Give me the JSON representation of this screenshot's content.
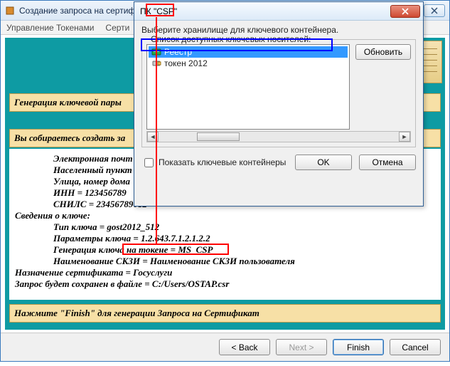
{
  "main": {
    "title": "Создание запроса на сертиф",
    "menu": {
      "tokens": "Управление Токенами",
      "certs": "Серти"
    }
  },
  "sections": {
    "keygen": "Генерация ключевой пары",
    "about_to_create": "Вы собираетесь создать за",
    "press_finish": "Нажмите \"Finish\" для генерации Запроса на Сертификат"
  },
  "details": {
    "email": "Электронная почт",
    "locality": "Населенный пункт",
    "street": "Улица, номер дома",
    "inn": "ИНН = 123456789",
    "snils": "СНИЛС = 23456789012",
    "key_heading": "Сведения о ключе:",
    "key_type": "Тип ключа = gost2012_512",
    "key_params": "Параметры ключа = 1.2.643.7.1.2.1.2.2",
    "key_on_token": "Генерация ключа на токене = MS_CSP",
    "skzi_name": "Наименование СКЗИ = Наименование СКЗИ пользователя",
    "purpose": "Назначение сертификата = Госуслуги",
    "save_path": "Запрос будет сохранен в файле = C:/Users/OSTAP.csr"
  },
  "footer": {
    "back": "< Back",
    "next": "Next >",
    "finish": "Finish",
    "cancel": "Cancel"
  },
  "dialog": {
    "title": "ПК \"CSP\"",
    "prompt": "Выберите хранилище для ключевого контейнера.",
    "group_label": "Список доступных ключевых носителей:",
    "items": {
      "registry": "Реестр",
      "token2012": "токен 2012"
    },
    "refresh": "Обновить",
    "show_containers": "Показать ключевые контейнеры",
    "ok": "OK",
    "cancel": "Отмена"
  }
}
